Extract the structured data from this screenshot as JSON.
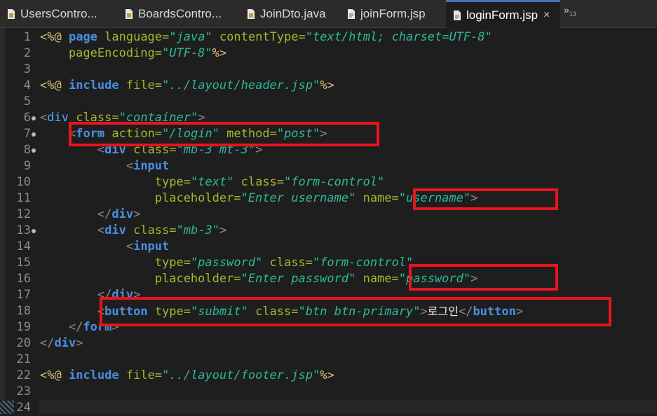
{
  "tabs": [
    {
      "label": "UsersContro...",
      "icon": "java-file-icon",
      "active": false
    },
    {
      "label": "BoardsContro...",
      "icon": "java-file-icon",
      "active": false
    },
    {
      "label": "JoinDto.java",
      "icon": "java-file-icon",
      "active": false
    },
    {
      "label": "joinForm.jsp",
      "icon": "jsp-file-icon",
      "active": false
    },
    {
      "label": "loginForm.jsp",
      "icon": "jsp-file-icon",
      "active": true
    }
  ],
  "close_glyph": "×",
  "overflow": {
    "chevron": "»",
    "count": "13"
  },
  "line_numbers": [
    "1",
    "2",
    "3",
    "4",
    "5",
    "6",
    "7",
    "8",
    "9",
    "10",
    "11",
    "12",
    "13",
    "14",
    "15",
    "16",
    "17",
    "18",
    "19",
    "20",
    "21",
    "22",
    "23",
    "24"
  ],
  "code": {
    "l1": {
      "open": "<%@ ",
      "kw": "page",
      "a1": " language=",
      "v1": "\"java\"",
      "a2": " contentType=",
      "v2": "\"text/html; charset=UTF-8\""
    },
    "l2": {
      "a1": "    pageEncoding=",
      "v1": "\"UTF-8\"",
      "close": "%>"
    },
    "l4": {
      "open": "<%@ ",
      "kw": "include",
      "a1": " file=",
      "v1": "\"../layout/header.jsp\"",
      "close": "%>"
    },
    "l6": {
      "lt": "<",
      "tag": "div",
      "a1": " class=",
      "v1": "\"container\"",
      "gt": ">"
    },
    "l7": {
      "indent": "    ",
      "lt": "<",
      "tag": "form",
      "a1": " action=",
      "v1": "\"/login\"",
      "a2": " method=",
      "v2": "\"post\"",
      "gt": ">"
    },
    "l8": {
      "indent": "        ",
      "lt": "<",
      "tag": "div",
      "a1": " class=",
      "v1": "\"mb-3 mt-3\"",
      "gt": ">"
    },
    "l9": {
      "indent": "            ",
      "lt": "<",
      "tag": "input"
    },
    "l10": {
      "a1": "                type=",
      "v1": "\"text\"",
      "a2": " class=",
      "v2": "\"form-control\""
    },
    "l11": {
      "a1": "                placeholder=",
      "v1": "\"Enter username\"",
      "a2": " name=",
      "v2": "\"username\"",
      "gt": ">"
    },
    "l12": {
      "indent": "        ",
      "lt": "</",
      "tag": "div",
      "gt": ">"
    },
    "l13": {
      "indent": "        ",
      "lt": "<",
      "tag": "div",
      "a1": " class=",
      "v1": "\"mb-3\"",
      "gt": ">"
    },
    "l14": {
      "indent": "            ",
      "lt": "<",
      "tag": "input"
    },
    "l15": {
      "a1": "                type=",
      "v1": "\"password\"",
      "a2": " class=",
      "v2": "\"form-control\""
    },
    "l16": {
      "a1": "                placeholder=",
      "v1": "\"Enter password\"",
      "a2": " name=",
      "v2": "\"password\"",
      "gt": ">"
    },
    "l17": {
      "indent": "        ",
      "lt": "</",
      "tag": "div",
      "gt": ">"
    },
    "l18": {
      "indent": "        ",
      "lt": "<",
      "tag": "button",
      "a1": " type=",
      "v1": "\"submit\"",
      "a2": " class=",
      "v2": "\"btn btn-primary\"",
      "gt": ">",
      "text": "로그인",
      "lt2": "</",
      "tag2": "button",
      "gt2": ">"
    },
    "l19": {
      "indent": "    ",
      "lt": "</",
      "tag": "form",
      "gt": ">"
    },
    "l20": {
      "lt": "</",
      "tag": "div",
      "gt": ">"
    },
    "l22": {
      "open": "<%@ ",
      "kw": "include",
      "a1": " file=",
      "v1": "\"../layout/footer.jsp\"",
      "close": "%>"
    }
  },
  "colors": {
    "highlight_border": "#e8141e",
    "editor_bg": "#1e1e1e",
    "active_tab_accent": "#4b74b8"
  }
}
